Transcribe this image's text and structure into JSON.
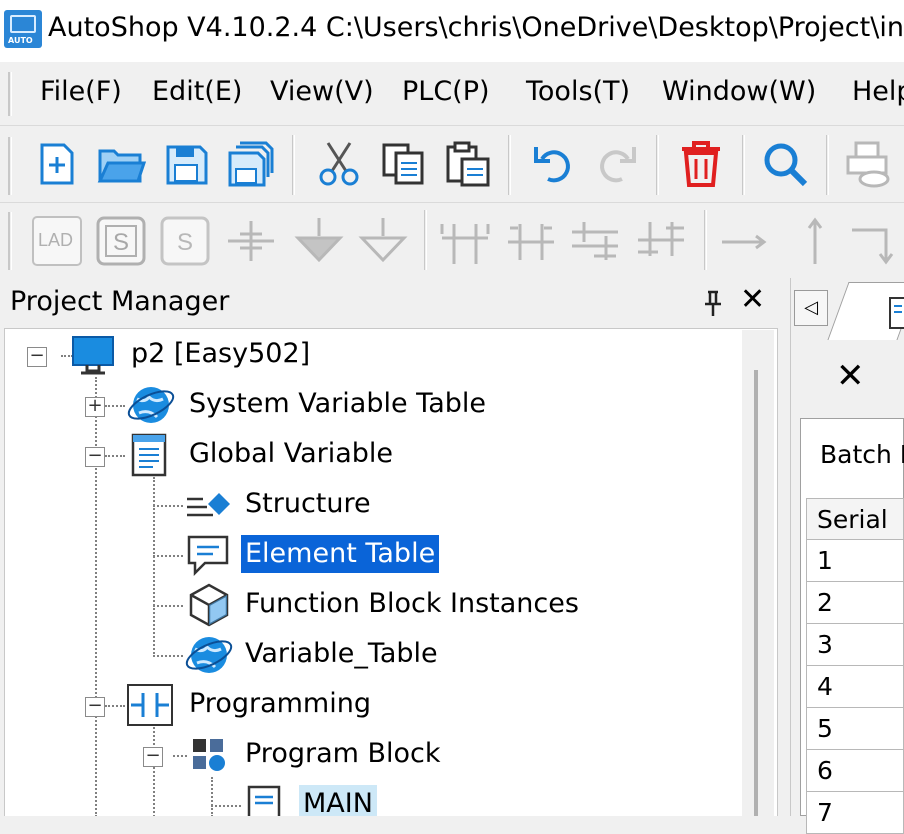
{
  "window": {
    "title": "AutoShop V4.10.2.4  C:\\Users\\chris\\OneDrive\\Desktop\\Project\\inv",
    "app_icon_text": "AUTO"
  },
  "menu": {
    "items": [
      "File(F)",
      "Edit(E)",
      "View(V)",
      "PLC(P)",
      "Tools(T)",
      "Window(W)",
      "Help"
    ]
  },
  "toolbar1": {
    "icons": [
      "new-file-icon",
      "open-folder-icon",
      "save-icon",
      "save-all-icon",
      "cut-icon",
      "copy-icon",
      "paste-icon",
      "undo-icon",
      "redo-icon",
      "delete-icon",
      "search-icon",
      "print-preview-icon"
    ]
  },
  "toolbar2": {
    "icons": [
      "lad-icon",
      "s-box-icon",
      "s-disabled-icon",
      "contact-icon",
      "arrow-down-filled-icon",
      "arrow-down-outline-icon",
      "parallel-contact-icon",
      "branch-contact-icon",
      "series-contact-icon",
      "coil-contact-icon",
      "horizontal-line-icon",
      "vertical-line-icon",
      "corner-line-icon"
    ],
    "lad_text": "LAD"
  },
  "project_manager": {
    "title": "Project Manager",
    "pin_glyph": "📌",
    "close_glyph": "✕",
    "tree": [
      {
        "label": "p2 [Easy502]",
        "icon": "monitor-icon",
        "expander": "−"
      },
      {
        "label": "System Variable Table",
        "icon": "globe-icon",
        "expander": "+"
      },
      {
        "label": "Global Variable",
        "icon": "document-list-icon",
        "expander": "−"
      },
      {
        "label": "Structure",
        "icon": "structure-icon"
      },
      {
        "label": "Element Table",
        "icon": "speech-bubble-icon",
        "selected": true
      },
      {
        "label": "Function Block Instances",
        "icon": "cube-icon"
      },
      {
        "label": "Variable_Table",
        "icon": "globe-icon"
      },
      {
        "label": "Programming",
        "icon": "ladder-contact-icon",
        "expander": "−"
      },
      {
        "label": "Program Block",
        "icon": "blocks-icon",
        "expander": "−"
      },
      {
        "label": "MAIN",
        "icon": "program-doc-icon",
        "hover": true
      }
    ]
  },
  "right_panel": {
    "tab_left_glyph": "◁",
    "close_glyph": "✕",
    "batch_label": "Batch D",
    "table": {
      "header": "Serial",
      "rows": [
        "1",
        "2",
        "3",
        "4",
        "5",
        "6",
        "7"
      ]
    }
  }
}
